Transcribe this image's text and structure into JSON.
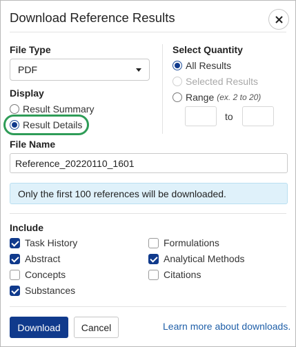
{
  "dialog": {
    "title": "Download Reference Results",
    "close_icon": "close-icon"
  },
  "file_type": {
    "label": "File Type",
    "selected": "PDF"
  },
  "display": {
    "label": "Display",
    "options": [
      {
        "label": "Result Summary",
        "checked": false
      },
      {
        "label": "Result Details",
        "checked": true
      }
    ]
  },
  "quantity": {
    "label": "Select Quantity",
    "options": [
      {
        "label": "All Results",
        "checked": true,
        "disabled": false
      },
      {
        "label": "Selected Results",
        "checked": false,
        "disabled": true
      },
      {
        "label": "Range",
        "checked": false,
        "disabled": false,
        "hint": "(ex. 2 to 20)"
      }
    ],
    "range_from": "",
    "range_to": "",
    "to_text": "to"
  },
  "file_name": {
    "label": "File Name",
    "value": "Reference_20220110_1601"
  },
  "info": {
    "message": "Only the first 100 references will be downloaded."
  },
  "include": {
    "label": "Include",
    "items": [
      {
        "label": "Task History",
        "checked": true
      },
      {
        "label": "Abstract",
        "checked": true
      },
      {
        "label": "Concepts",
        "checked": false
      },
      {
        "label": "Substances",
        "checked": true
      },
      {
        "label": "Formulations",
        "checked": false
      },
      {
        "label": "Analytical Methods",
        "checked": true
      },
      {
        "label": "Citations",
        "checked": false
      }
    ]
  },
  "footer": {
    "download_label": "Download",
    "cancel_label": "Cancel",
    "learn_more": "Learn more about downloads."
  },
  "colors": {
    "primary": "#103a8c",
    "highlight": "#2e9c57",
    "info_bg": "#dff1fa",
    "link": "#1f5fa8"
  }
}
